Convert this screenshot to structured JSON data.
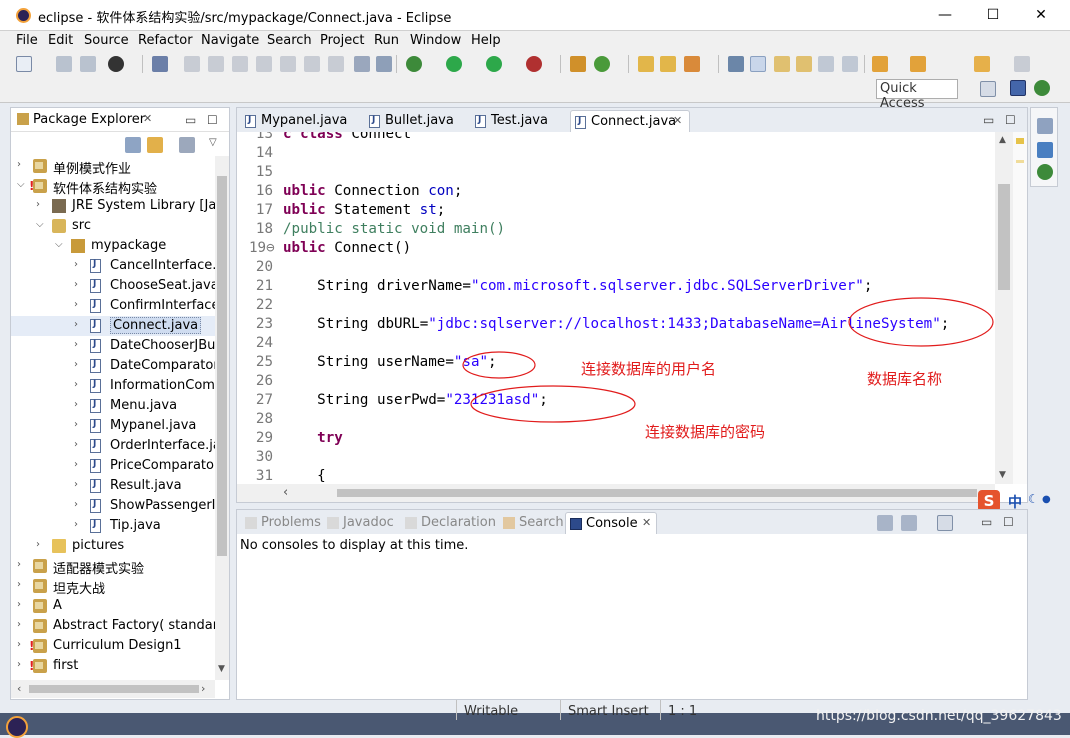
{
  "window": {
    "title": "eclipse - 软件体系结构实验/src/mypackage/Connect.java - Eclipse",
    "controls": [
      "—",
      "☐",
      "✕"
    ]
  },
  "menu": [
    "File",
    "Edit",
    "Source",
    "Refactor",
    "Navigate",
    "Search",
    "Project",
    "Run",
    "Window",
    "Help"
  ],
  "toolbar": {
    "quick_access_label": "Quick Access"
  },
  "package_explorer": {
    "title": "Package Explorer",
    "tree": [
      {
        "label": "单例模式作业",
        "kind": "proj",
        "expanded": false
      },
      {
        "label": "软件体系结构实验",
        "kind": "proj-err",
        "expanded": true
      },
      {
        "label": "JRE System Library [Java",
        "kind": "lib",
        "expanded": false
      },
      {
        "label": "src",
        "kind": "src",
        "expanded": true
      },
      {
        "label": "mypackage",
        "kind": "pkg",
        "expanded": true
      },
      {
        "label": "CancelInterface.ja",
        "kind": "jfile"
      },
      {
        "label": "ChooseSeat.java",
        "kind": "jfile"
      },
      {
        "label": "ConfirmInterface.",
        "kind": "jfile"
      },
      {
        "label": "Connect.java",
        "kind": "jfile",
        "selected": true
      },
      {
        "label": "DateChooserJBut",
        "kind": "jfile"
      },
      {
        "label": "DateComparator.",
        "kind": "jfile"
      },
      {
        "label": "InformationComp",
        "kind": "jfile"
      },
      {
        "label": "Menu.java",
        "kind": "jfile"
      },
      {
        "label": "Mypanel.java",
        "kind": "jfile"
      },
      {
        "label": "OrderInterface.ja",
        "kind": "jfile"
      },
      {
        "label": "PriceComparator.",
        "kind": "jfile"
      },
      {
        "label": "Result.java",
        "kind": "jfile"
      },
      {
        "label": "ShowPassengerIr",
        "kind": "jfile"
      },
      {
        "label": "Tip.java",
        "kind": "jfile"
      },
      {
        "label": "pictures",
        "kind": "folder",
        "expanded": false
      },
      {
        "label": "适配器模式实验",
        "kind": "proj",
        "expanded": false
      },
      {
        "label": "坦克大战",
        "kind": "proj",
        "expanded": false
      },
      {
        "label": "A",
        "kind": "proj",
        "expanded": false
      },
      {
        "label": "Abstract Factory( standard",
        "kind": "proj",
        "expanded": false
      },
      {
        "label": "Curriculum Design1",
        "kind": "proj-err",
        "expanded": false
      },
      {
        "label": "first",
        "kind": "proj-err",
        "expanded": false
      }
    ]
  },
  "editor": {
    "tabs": [
      "Mypanel.java",
      "Bullet.java",
      "Test.java",
      "Connect.java"
    ],
    "active_tab": "Connect.java",
    "lines": [
      {
        "n": "13",
        "parts": [
          {
            "t": "c class ",
            "c": "kw"
          },
          {
            "t": "Connect",
            "c": "plain"
          }
        ]
      },
      {
        "n": "14",
        "parts": []
      },
      {
        "n": "15",
        "parts": []
      },
      {
        "n": "16",
        "parts": [
          {
            "t": "ublic ",
            "c": "kw"
          },
          {
            "t": "Connection ",
            "c": "plain"
          },
          {
            "t": "con",
            "c": "fld"
          },
          {
            "t": ";",
            "c": "plain"
          }
        ]
      },
      {
        "n": "17",
        "parts": [
          {
            "t": "ublic ",
            "c": "kw"
          },
          {
            "t": "Statement ",
            "c": "plain"
          },
          {
            "t": "st",
            "c": "fld"
          },
          {
            "t": ";",
            "c": "plain"
          }
        ]
      },
      {
        "n": "18",
        "parts": [
          {
            "t": "/public static void main()",
            "c": "cm"
          }
        ]
      },
      {
        "n": "19⊖",
        "parts": [
          {
            "t": "ublic ",
            "c": "kw"
          },
          {
            "t": "Connect()",
            "c": "plain"
          }
        ]
      },
      {
        "n": "20",
        "parts": []
      },
      {
        "n": "21",
        "parts": [
          {
            "t": "    String ",
            "c": "plain"
          },
          {
            "t": "driverName",
            "c": "plain"
          },
          {
            "t": "=",
            "c": "plain"
          },
          {
            "t": "\"com.microsoft.sqlserver.jdbc.SQLServerDriver\"",
            "c": "str"
          },
          {
            "t": ";",
            "c": "plain"
          }
        ]
      },
      {
        "n": "22",
        "parts": []
      },
      {
        "n": "23",
        "parts": [
          {
            "t": "    String ",
            "c": "plain"
          },
          {
            "t": "dbURL",
            "c": "plain"
          },
          {
            "t": "=",
            "c": "plain"
          },
          {
            "t": "\"jdbc:sqlserver://localhost:1433;DatabaseName=AirlineSystem\"",
            "c": "str"
          },
          {
            "t": ";",
            "c": "plain"
          }
        ]
      },
      {
        "n": "24",
        "parts": []
      },
      {
        "n": "25",
        "parts": [
          {
            "t": "    String ",
            "c": "plain"
          },
          {
            "t": "userName",
            "c": "plain"
          },
          {
            "t": "=",
            "c": "plain"
          },
          {
            "t": "\"sa\"",
            "c": "str"
          },
          {
            "t": ";",
            "c": "plain"
          }
        ]
      },
      {
        "n": "26",
        "parts": []
      },
      {
        "n": "27",
        "parts": [
          {
            "t": "    String ",
            "c": "plain"
          },
          {
            "t": "userPwd",
            "c": "plain"
          },
          {
            "t": "=",
            "c": "plain"
          },
          {
            "t": "\"231231asd\"",
            "c": "str"
          },
          {
            "t": ";",
            "c": "plain"
          }
        ]
      },
      {
        "n": "28",
        "parts": []
      },
      {
        "n": "29",
        "parts": [
          {
            "t": "    try",
            "c": "kw"
          }
        ]
      },
      {
        "n": "30",
        "parts": []
      },
      {
        "n": "31",
        "parts": [
          {
            "t": "    {",
            "c": "plain"
          }
        ]
      }
    ],
    "annotations": {
      "username_note": "连接数据库的用户名",
      "dbname_note": "数据库名称",
      "password_note": "连接数据库的密码"
    }
  },
  "console_panel": {
    "tabs": [
      "Problems",
      "Javadoc",
      "Declaration",
      "Search",
      "Console"
    ],
    "active_tab": "Console",
    "message": "No consoles to display at this time."
  },
  "ime": {
    "mode": "中"
  },
  "statusbar": {
    "writable": "Writable",
    "insert_mode": "Smart Insert",
    "position": "1 : 1",
    "watermark": "https://blog.csdn.net/qq_39627843"
  }
}
